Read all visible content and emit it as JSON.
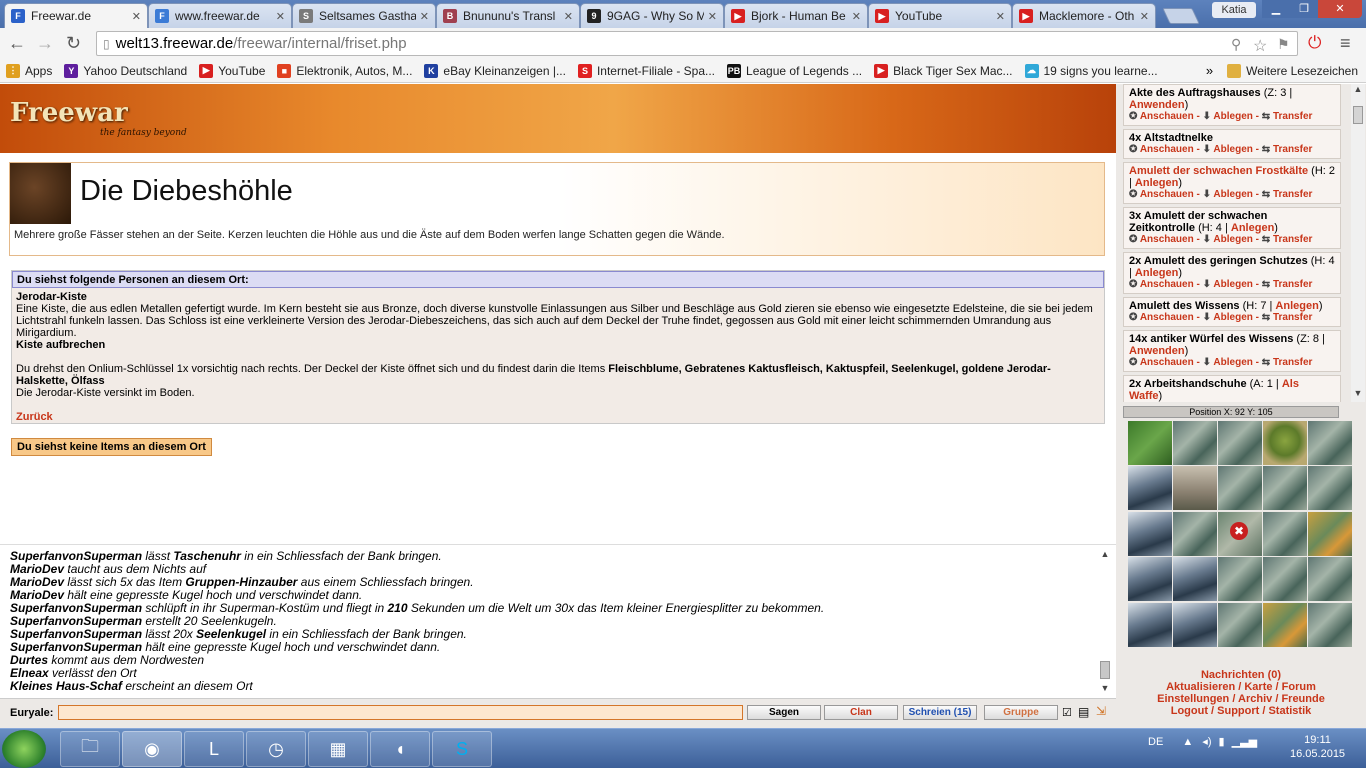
{
  "browser": {
    "tabs": [
      {
        "title": "Freewar.de",
        "fav": "#2b61c9",
        "glyph": "F"
      },
      {
        "title": "www.freewar.de",
        "fav": "#3b7bd6",
        "glyph": "F"
      },
      {
        "title": "Seltsames Gastha",
        "fav": "#7a7a7a",
        "glyph": "S"
      },
      {
        "title": "Bnununu's Transl",
        "fav": "#a04050",
        "glyph": "B"
      },
      {
        "title": "9GAG - Why So M",
        "fav": "#222222",
        "glyph": "9"
      },
      {
        "title": "Bjork - Human Be",
        "fav": "#d82020",
        "glyph": "▶"
      },
      {
        "title": "YouTube",
        "fav": "#d82020",
        "glyph": "▶"
      },
      {
        "title": "Macklemore - Oth",
        "fav": "#d82020",
        "glyph": "▶"
      }
    ],
    "user": "Katia",
    "url_host": "welt13.freewar.de",
    "url_path": "/freewar/internal/friset.php",
    "bookmarks": [
      {
        "label": "Apps",
        "color": "#e0a020",
        "glyph": "⋮"
      },
      {
        "label": "Yahoo Deutschland",
        "color": "#5e1e9e",
        "glyph": "Y"
      },
      {
        "label": "YouTube",
        "color": "#d82020",
        "glyph": "▶"
      },
      {
        "label": "Elektronik, Autos, M...",
        "color": "#e04020",
        "glyph": "■"
      },
      {
        "label": "eBay Kleinanzeigen |...",
        "color": "#2040a0",
        "glyph": "K"
      },
      {
        "label": "Internet-Filiale - Spa...",
        "color": "#e02020",
        "glyph": "S"
      },
      {
        "label": "League of Legends ...",
        "color": "#111111",
        "glyph": "PB"
      },
      {
        "label": "Black Tiger Sex Mac...",
        "color": "#d82020",
        "glyph": "▶"
      },
      {
        "label": "19 signs you learne...",
        "color": "#30a8d8",
        "glyph": "☁"
      }
    ],
    "overflow": "»",
    "other_bookmarks": "Weitere Lesezeichen"
  },
  "game": {
    "logo": "Freewar",
    "logo_sub": "the fantasy beyond",
    "place_title": "Die Diebeshöhle",
    "place_desc": "Mehrere große Fässer stehen an der Seite. Kerzen leuchten die Höhle aus und die Äste auf dem Boden werfen lange Schatten gegen die Wände.",
    "persons_header": "Du siehst folgende Personen an diesem Ort:",
    "npc_name": "Jerodar-Kiste",
    "npc_desc": "Eine Kiste, die aus edlen Metallen gefertigt wurde. Im Kern besteht sie aus Bronze, doch diverse kunstvolle Einlassungen aus Silber und Beschläge aus Gold zieren sie ebenso wie eingesetzte Edelsteine, die sie bei jedem Lichtstrahl funkeln lassen. Das Schloss ist eine verkleinerte Version des Jerodar-Diebeszeichens, das sich auch auf dem Deckel der Truhe findet, gegossen aus Gold mit einer leicht schimmernden Umrandung aus Mirigardium.",
    "npc_action": "Kiste aufbrechen",
    "result_intro": "Du drehst den Onlium-Schlüssel 1x vorsichtig nach rechts. Der Deckel der Kiste öffnet sich und du findest darin die Items",
    "result_items": "Fleischblume, Gebratenes Kaktusfleisch, Kaktuspfeil, Seelenkugel, goldene Jerodar-Halskette, Ölfass",
    "result_end": "Die Jerodar-Kiste versinkt im Boden.",
    "back": "Zurück",
    "no_items": "Du siehst keine Items an diesem Ort"
  },
  "chat": {
    "lines": [
      {
        "who": "SuperfanvonSuperman",
        "text": " lässt ",
        "b": "Taschenuhr",
        "rest": " in ein Schliessfach der Bank bringen."
      },
      {
        "who": "MarioDev",
        "text": " taucht aus dem Nichts auf",
        "b": "",
        "rest": ""
      },
      {
        "who": "MarioDev",
        "text": " lässt sich 5x das Item ",
        "b": "Gruppen-Hinzauber",
        "rest": " aus einem Schliessfach bringen."
      },
      {
        "who": "MarioDev",
        "text": " hält eine gepresste Kugel hoch und verschwindet dann.",
        "b": "",
        "rest": ""
      },
      {
        "who": "SuperfanvonSuperman",
        "text": " schlüpft in ihr Superman-Kostüm und fliegt in ",
        "b": "210",
        "rest": " Sekunden um die Welt um 30x das Item kleiner Energiesplitter zu bekommen."
      },
      {
        "who": "SuperfanvonSuperman",
        "text": " erstellt 20 Seelenkugeln.",
        "b": "",
        "rest": ""
      },
      {
        "who": "SuperfanvonSuperman",
        "text": " lässt 20x ",
        "b": "Seelenkugel",
        "rest": " in ein Schliessfach der Bank bringen."
      },
      {
        "who": "SuperfanvonSuperman",
        "text": " hält eine gepresste Kugel hoch und verschwindet dann.",
        "b": "",
        "rest": ""
      },
      {
        "who": "Durtes",
        "text": " kommt aus dem Nordwesten",
        "b": "",
        "rest": ""
      },
      {
        "who": "Elneax",
        "text": " verlässt den Ort",
        "b": "",
        "rest": ""
      },
      {
        "who": "Kleines Haus-Schaf",
        "text": " erscheint an diesem Ort",
        "b": "",
        "rest": ""
      }
    ],
    "input_label": "Euryale:",
    "btn_say": "Sagen",
    "btn_clan": "Clan",
    "btn_shout": "Schreien (15)",
    "btn_group": "Gruppe"
  },
  "inventory": {
    "items": [
      {
        "name": "Akte des Auftragshauses",
        "meta": " (Z: 3 | ",
        "link": "Anwenden",
        "tail": ")",
        "red": false
      },
      {
        "name": "4x Altstadtnelke",
        "meta": "",
        "link": "",
        "tail": "",
        "red": false
      },
      {
        "name": "Amulett der schwachen Frostkälte",
        "meta": " (H: 2 | ",
        "link": "Anlegen",
        "tail": ")",
        "red": true
      },
      {
        "name": "3x Amulett der schwachen Zeitkontrolle",
        "meta": " (H: 4 | ",
        "link": "Anlegen",
        "tail": ")",
        "red": false
      },
      {
        "name": "2x Amulett des geringen Schutzes",
        "meta": " (H: 4 | ",
        "link": "Anlegen",
        "tail": ")",
        "red": false
      },
      {
        "name": "Amulett des Wissens",
        "meta": " (H: 7 | ",
        "link": "Anlegen",
        "tail": ")",
        "red": false
      },
      {
        "name": "14x antiker Würfel des Wissens",
        "meta": " (Z: 8 | ",
        "link": "Anwenden",
        "tail": ")",
        "red": false
      },
      {
        "name": "2x Arbeitshandschuhe",
        "meta": " (A: 1 | ",
        "link": "Als Waffe",
        "tail": ")",
        "red": false
      }
    ],
    "action_view": "Anschauen",
    "action_drop": "Ablegen",
    "action_transfer": "Transfer",
    "position": "Position X: 92 Y: 105",
    "map_tiles": [
      "forest",
      "rocks",
      "rocks",
      "tree",
      "rocks",
      "mountain",
      "house",
      "rocks",
      "rocks",
      "rocks",
      "mountain",
      "rocks",
      "player",
      "rocks",
      "autumn",
      "mountain",
      "mountain",
      "rocks",
      "rocks",
      "rocks",
      "mountain",
      "mountain",
      "rocks",
      "autumn",
      "rocks"
    ],
    "links": [
      {
        "label": "Nachrichten (0)"
      },
      {
        "label": "Aktualisieren / Karte / Forum"
      },
      {
        "label": "Einstellungen / Archiv / Freunde"
      },
      {
        "label": "Logout / Support / Statistik"
      }
    ]
  },
  "taskbar": {
    "lang": "DE",
    "time": "19:11",
    "date": "16.05.2015"
  }
}
